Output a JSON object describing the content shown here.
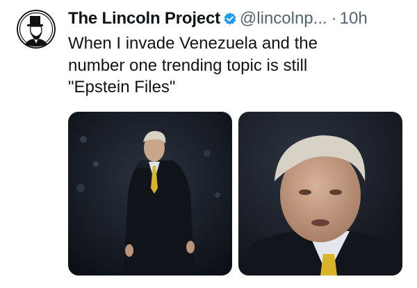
{
  "post": {
    "author": "The Lincoln Project",
    "handle": "@lincolnp...",
    "separator": "·",
    "time": "10h",
    "text": "When I invade Venezuela and the\nnumber one trending topic is still\n\"Epstein Files\"",
    "media": [
      {
        "description_icon": "photo-full-body"
      },
      {
        "description_icon": "photo-closeup"
      }
    ]
  },
  "colors": {
    "verified": "#1d9bf0",
    "secondary_text": "#536471",
    "tie": "#d9b42a"
  }
}
